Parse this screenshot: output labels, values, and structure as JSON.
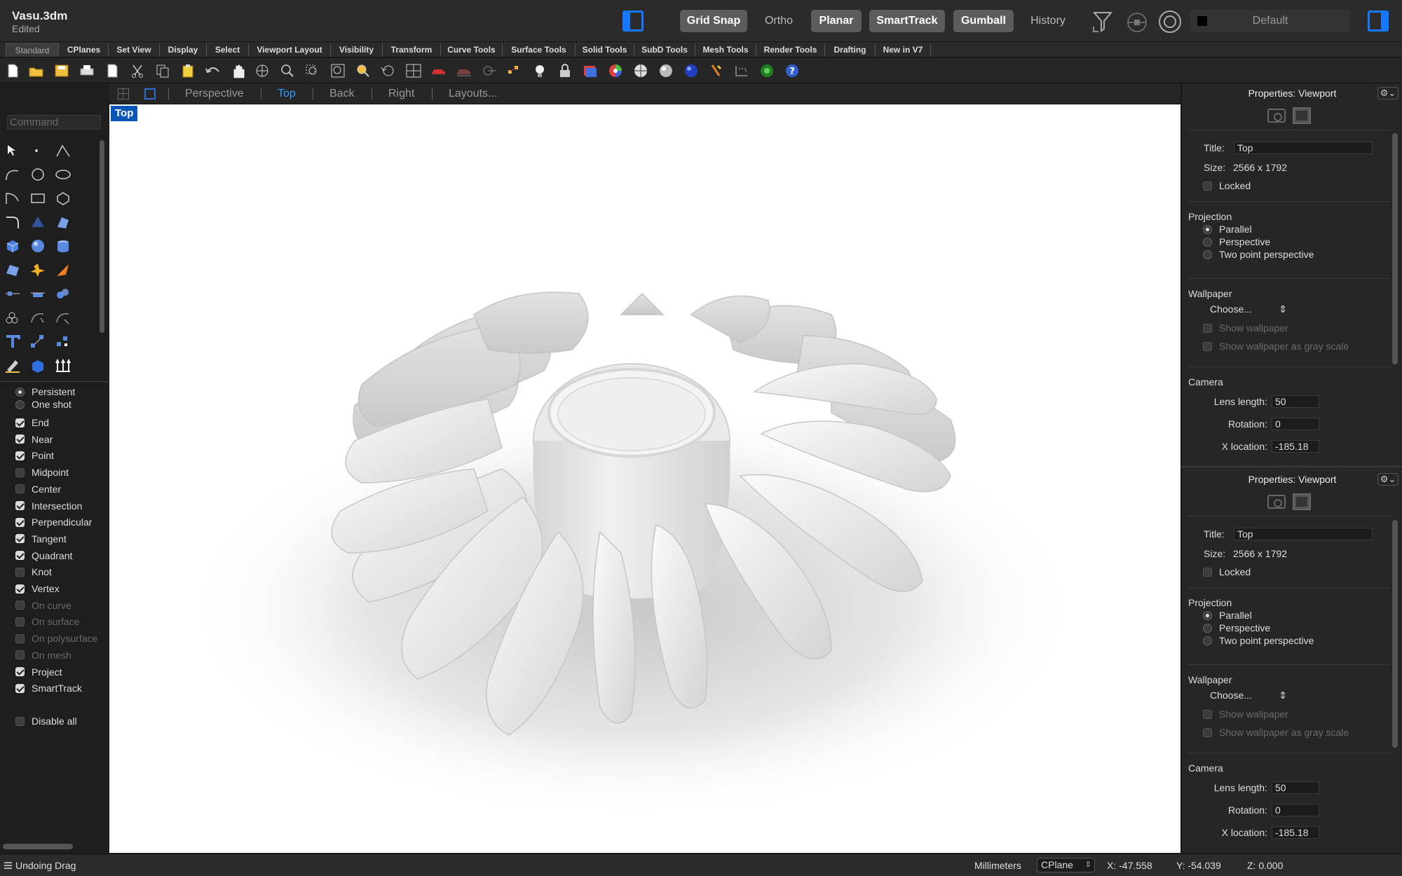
{
  "document": {
    "name": "Vasu.3dm",
    "status": "Edited"
  },
  "modes": [
    {
      "label": "Grid Snap",
      "on": true
    },
    {
      "label": "Ortho",
      "on": false
    },
    {
      "label": "Planar",
      "on": true
    },
    {
      "label": "SmartTrack",
      "on": true
    },
    {
      "label": "Gumball",
      "on": true
    },
    {
      "label": "History",
      "on": false
    }
  ],
  "layer": {
    "name": "Default",
    "color": "#000000"
  },
  "toolbar_tabs": [
    "Standard",
    "CPlanes",
    "Set View",
    "Display",
    "Select",
    "Viewport Layout",
    "Visibility",
    "Transform",
    "Curve Tools",
    "Surface Tools",
    "Solid Tools",
    "SubD Tools",
    "Mesh Tools",
    "Render Tools",
    "Drafting",
    "New in V7"
  ],
  "command": {
    "placeholder": "Command"
  },
  "viewport_tabs": [
    "Perspective",
    "Top",
    "Back",
    "Right",
    "Layouts..."
  ],
  "active_viewport": "Top",
  "viewport_label": "Top",
  "osnap": {
    "modes": [
      {
        "label": "Persistent",
        "selected": true
      },
      {
        "label": "One shot",
        "selected": false
      }
    ],
    "items": [
      {
        "label": "End",
        "checked": true,
        "enabled": true
      },
      {
        "label": "Near",
        "checked": true,
        "enabled": true
      },
      {
        "label": "Point",
        "checked": true,
        "enabled": true
      },
      {
        "label": "Midpoint",
        "checked": false,
        "enabled": true
      },
      {
        "label": "Center",
        "checked": false,
        "enabled": true
      },
      {
        "label": "Intersection",
        "checked": true,
        "enabled": true
      },
      {
        "label": "Perpendicular",
        "checked": true,
        "enabled": true
      },
      {
        "label": "Tangent",
        "checked": true,
        "enabled": true
      },
      {
        "label": "Quadrant",
        "checked": true,
        "enabled": true
      },
      {
        "label": "Knot",
        "checked": false,
        "enabled": true
      },
      {
        "label": "Vertex",
        "checked": true,
        "enabled": true
      },
      {
        "label": "On curve",
        "checked": false,
        "enabled": false
      },
      {
        "label": "On surface",
        "checked": false,
        "enabled": false
      },
      {
        "label": "On polysurface",
        "checked": false,
        "enabled": false
      },
      {
        "label": "On mesh",
        "checked": false,
        "enabled": false
      },
      {
        "label": "Project",
        "checked": true,
        "enabled": true
      },
      {
        "label": "SmartTrack",
        "checked": true,
        "enabled": true
      }
    ],
    "disable_all": "Disable all"
  },
  "properties": {
    "header": "Properties: Viewport",
    "gear": "⚙︎⌄",
    "title_label": "Title:",
    "title_value": "Top",
    "size_label": "Size:",
    "size_value": "2566 x 1792",
    "locked_label": "Locked",
    "projection_label": "Projection",
    "projection_options": [
      "Parallel",
      "Perspective",
      "Two point perspective"
    ],
    "projection_selected": "Parallel",
    "wallpaper_label": "Wallpaper",
    "wallpaper_choose": "Choose...",
    "show_wallpaper": "Show wallpaper",
    "show_wallpaper_gray": "Show wallpaper as gray scale",
    "camera_label": "Camera",
    "lens_label": "Lens length:",
    "lens_value": "50",
    "rotation_label": "Rotation:",
    "rotation_value": "0",
    "xloc_label": "X location:",
    "xloc_value": "-185.18"
  },
  "status": {
    "message": "Undoing Drag",
    "units": "Millimeters",
    "cplane": "CPlane",
    "x": "X: -47.558",
    "y": "Y: -54.039",
    "z": "Z: 0.000"
  },
  "colors": {
    "accent": "#1479ff",
    "active_tab": "#2e9bff",
    "viewport_label_bg": "#0a55b8"
  }
}
